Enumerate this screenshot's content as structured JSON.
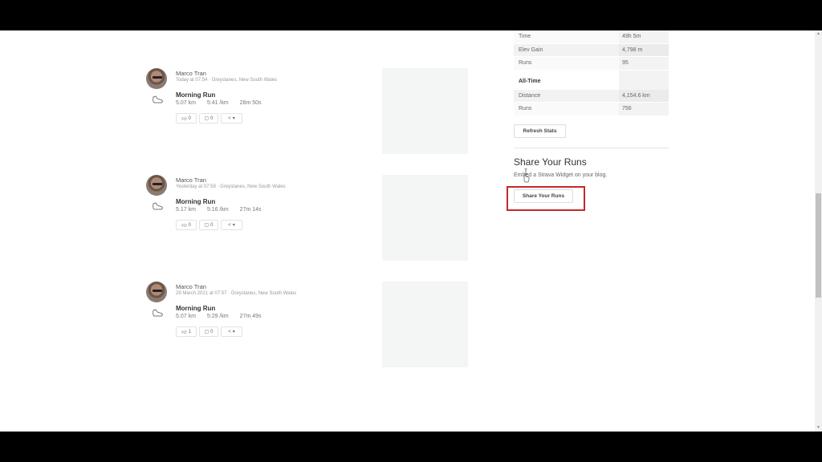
{
  "feed": [
    {
      "athlete": "Marco Tran",
      "meta": "Today at 07:54 · Greystanes, New South Wales",
      "title": "Morning Run",
      "distance": "5.07 km",
      "pace": "5:41 /km",
      "time": "28m 50s",
      "kudos": "0",
      "comments": "0"
    },
    {
      "athlete": "Marco Tran",
      "meta": "Yesterday at 07:59 · Greystanes, New South Wales",
      "title": "Morning Run",
      "distance": "5.17 km",
      "pace": "5:16 /km",
      "time": "27m 14s",
      "kudos": "0",
      "comments": "0"
    },
    {
      "athlete": "Marco Tran",
      "meta": "29 March 2021 at 07:57 · Greystanes, New South Wales",
      "title": "Morning Run",
      "distance": "5.07 km",
      "pace": "5:29 /km",
      "time": "27m 49s",
      "kudos": "1",
      "comments": "0"
    }
  ],
  "sidebar": {
    "year_stats": [
      {
        "label": "Time",
        "value": "49h 5m"
      },
      {
        "label": "Elev Gain",
        "value": "4,798 m"
      },
      {
        "label": "Runs",
        "value": "95"
      }
    ],
    "all_time_heading": "All-Time",
    "all_time_stats": [
      {
        "label": "Distance",
        "value": "4,154.6 km"
      },
      {
        "label": "Runs",
        "value": "756"
      }
    ],
    "refresh_label": "Refresh Stats",
    "share_heading": "Share Your Runs",
    "share_description": "Embed a Strava Widget on your blog.",
    "share_button_label": "Share Your Runs"
  },
  "scrollbar": {
    "position_fraction": 0.55
  }
}
